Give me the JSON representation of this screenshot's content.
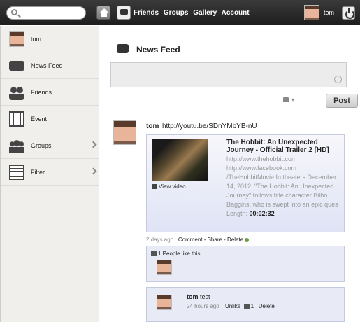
{
  "topbar": {
    "search_placeholder": "",
    "nav": [
      "Friends",
      "Groups",
      "Gallery",
      "Account"
    ],
    "user_name": "tom"
  },
  "sidebar": {
    "items": [
      {
        "label": "tom",
        "icon": "user-avatar"
      },
      {
        "label": "News Feed",
        "icon": "chat-icon"
      },
      {
        "label": "Friends",
        "icon": "friends-icon"
      },
      {
        "label": "Event",
        "icon": "calendar-icon"
      },
      {
        "label": "Groups",
        "icon": "groups-icon"
      },
      {
        "label": "Filter",
        "icon": "filter-icon"
      }
    ]
  },
  "feed": {
    "title": "News Feed",
    "composer_placeholder": "",
    "post_button": "Post",
    "post": {
      "author": "tom",
      "link": "http://youtu.be/SDnYMbYB-nU",
      "attachment": {
        "title": "The Hobbit: An Unexpected Journey - Official Trailer 2 [HD]",
        "description": "http://www.thehobbit.com http://www.facebook.com /TheHobbitMovie In theaters December 14, 2012. \"The Hobbit: An Unexpected Journey\" follows title character Bilbo Baggins, who is swept into an epic ques",
        "length_label": "Length:",
        "length_value": "00:02:32",
        "view_video": "View video"
      },
      "meta": {
        "age": "2 days ago",
        "actions": "Comment - Share - Delete"
      },
      "likes": {
        "count_text": "1 People like this"
      },
      "comment": {
        "author": "tom",
        "text": "test",
        "age": "24 hours ago",
        "unlike": "Unlike",
        "like_count": "1",
        "delete": "Delete"
      }
    }
  },
  "colors": {
    "topbar": "#2b2b2b",
    "sidebar_bg": "#f0efec",
    "attachment_bg": "#dfe3f5"
  }
}
